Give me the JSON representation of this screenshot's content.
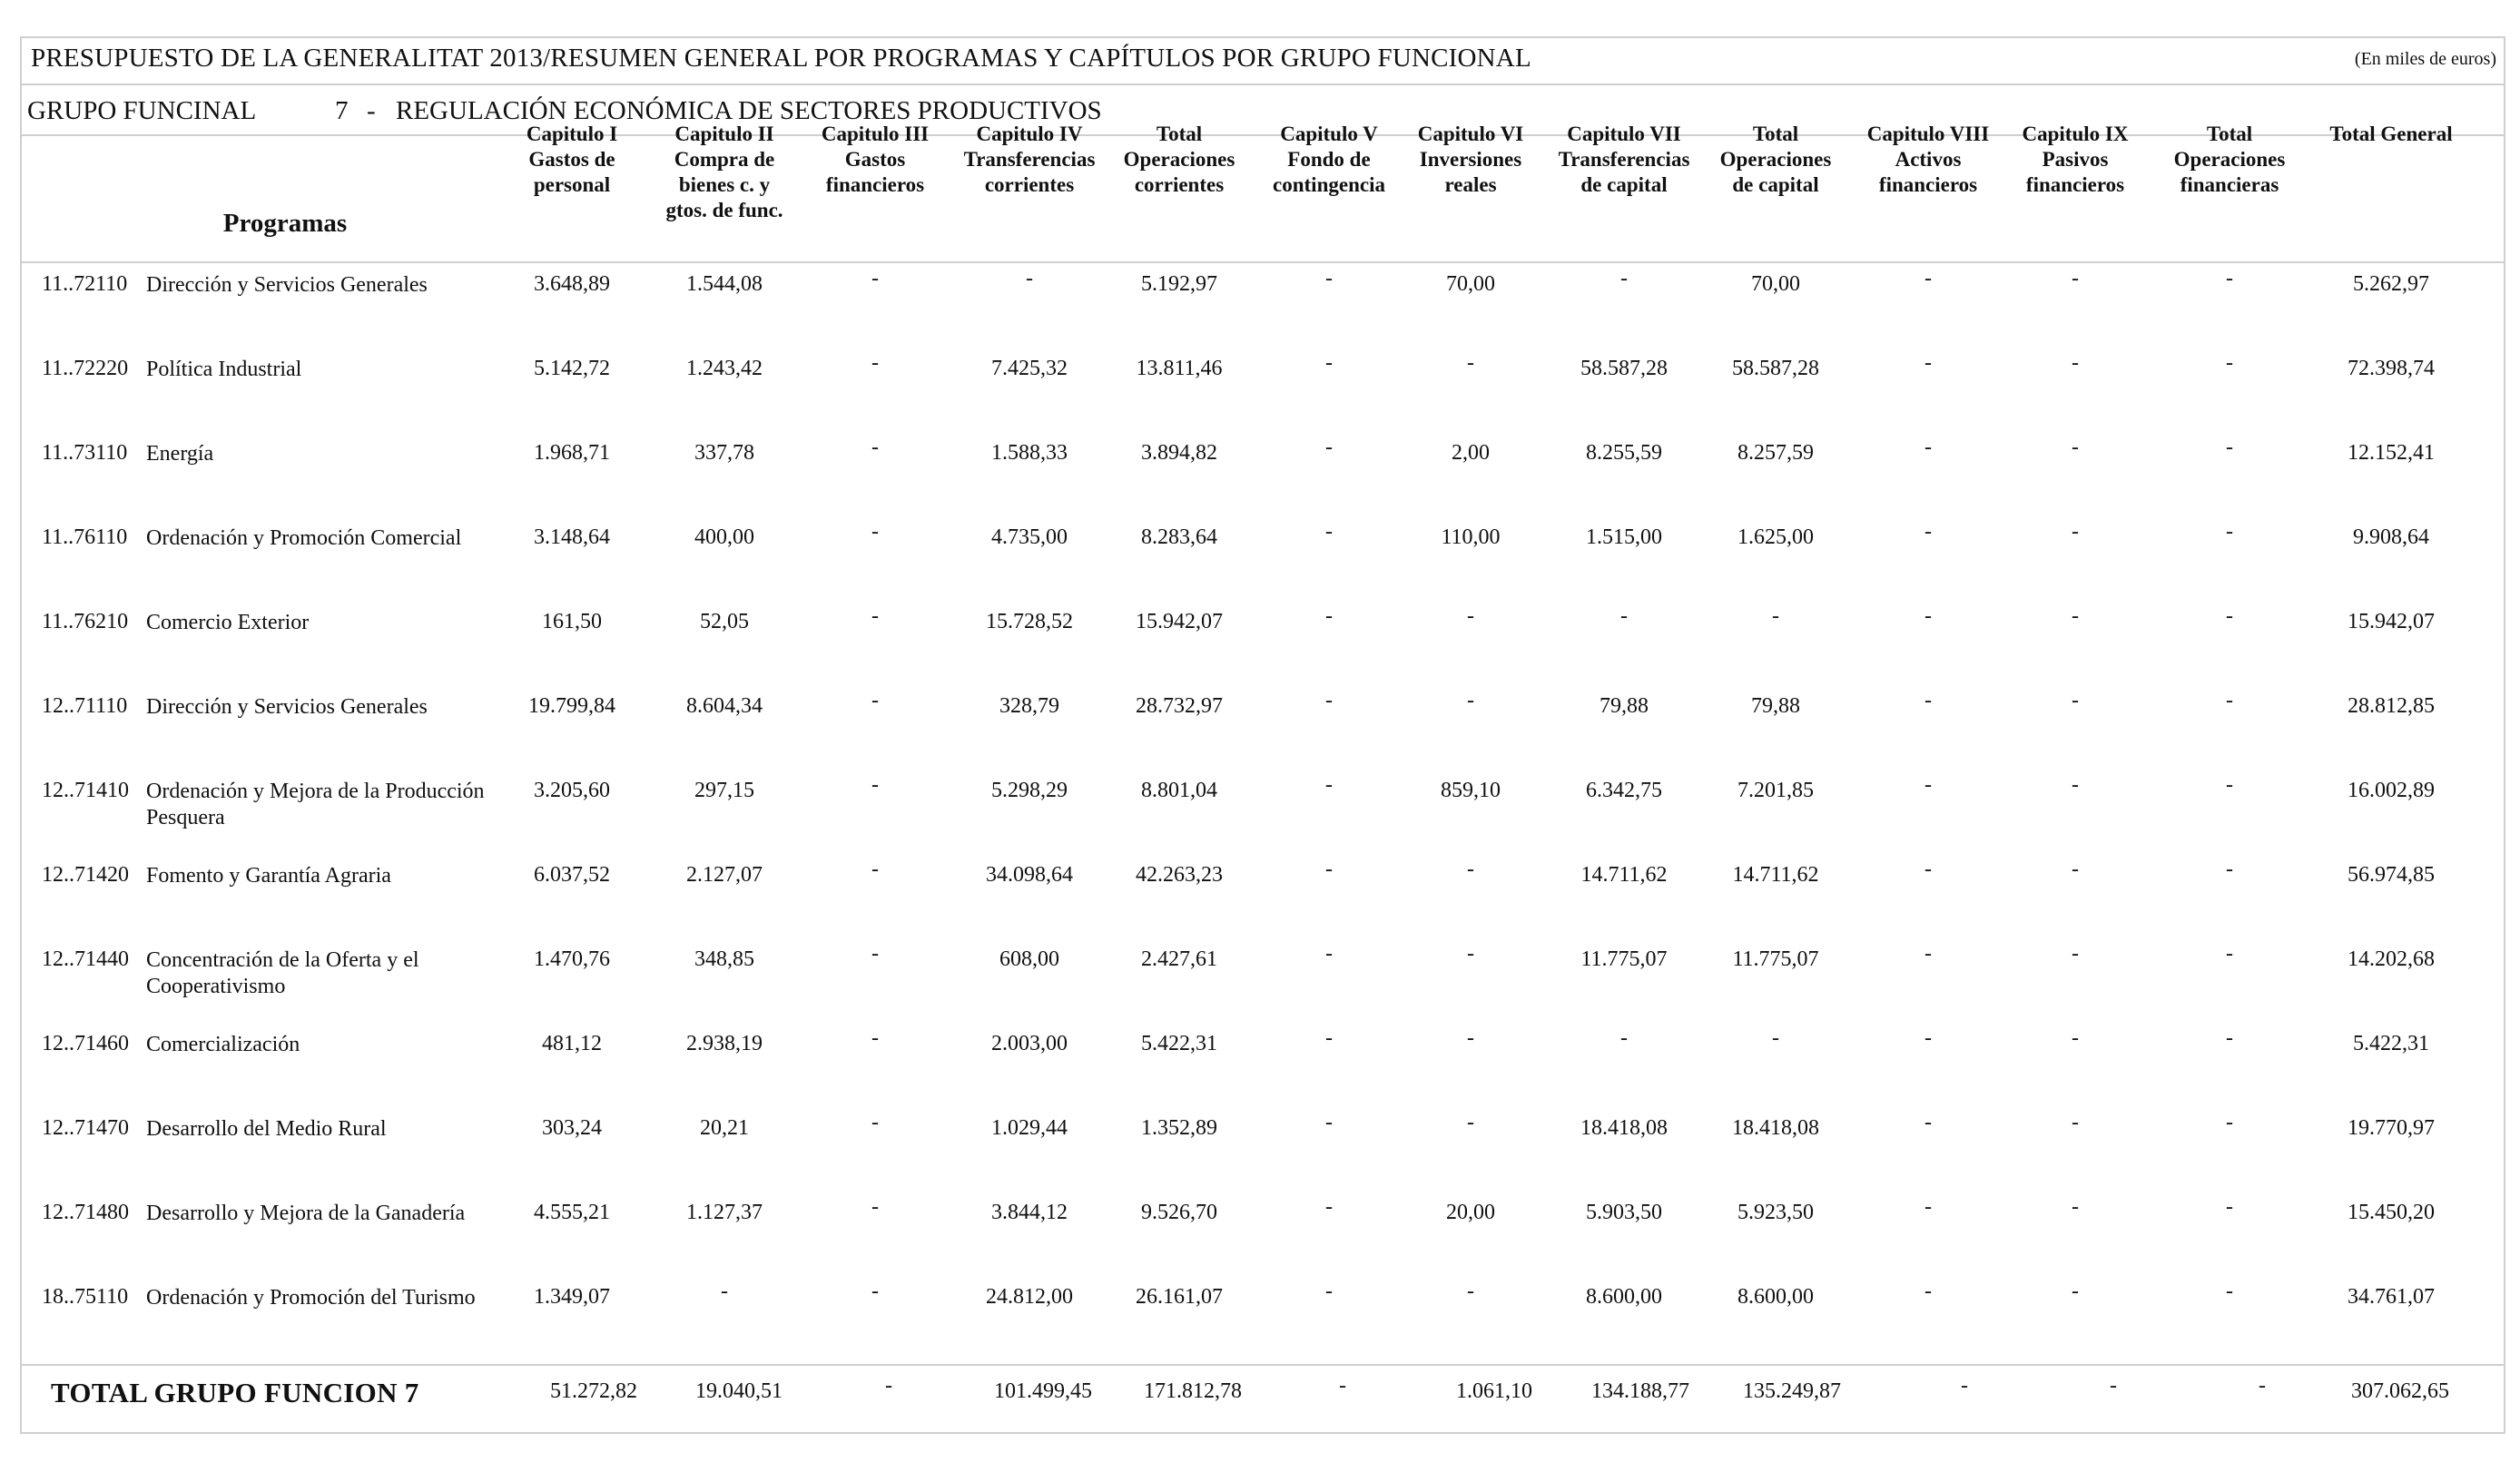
{
  "document": {
    "title": "PRESUPUESTO DE LA GENERALITAT 2013/RESUMEN GENERAL POR PROGRAMAS Y CAPÍTULOS POR GRUPO FUNCIONAL",
    "units": "(En miles de euros)",
    "group_label": "GRUPO FUNCINAL",
    "group_number": "7",
    "group_dash": "-",
    "group_name": "REGULACIÓN ECONÓMICA DE SECTORES PRODUCTIVOS"
  },
  "table": {
    "program_header": "Programas",
    "columns": [
      "Capitulo I\nGastos de\npersonal",
      "Capitulo II\nCompra de\nbienes c. y\ngtos. de func.",
      "Capitulo III\nGastos\nfinancieros",
      "Capitulo IV\nTransferencias\ncorrientes",
      "Total\nOperaciones\ncorrientes",
      "Capitulo V\nFondo de\ncontingencia",
      "Capitulo VI\nInversiones\nreales",
      "Capitulo VII\nTransferencias\nde capital",
      "Total\nOperaciones\nde capital",
      "Capitulo VIII\nActivos\nfinancieros",
      "Capitulo IX\nPasivos\nfinancieros",
      "Total\nOperaciones\nfinancieras",
      "Total General"
    ],
    "rows": [
      {
        "code": "11..72110",
        "name": "Dirección y Servicios Generales",
        "values": [
          "3.648,89",
          "1.544,08",
          "-",
          "-",
          "5.192,97",
          "-",
          "70,00",
          "-",
          "70,00",
          "-",
          "-",
          "-",
          "5.262,97"
        ]
      },
      {
        "code": "11..72220",
        "name": "Política Industrial",
        "values": [
          "5.142,72",
          "1.243,42",
          "-",
          "7.425,32",
          "13.811,46",
          "-",
          "-",
          "58.587,28",
          "58.587,28",
          "-",
          "-",
          "-",
          "72.398,74"
        ]
      },
      {
        "code": "11..73110",
        "name": "Energía",
        "values": [
          "1.968,71",
          "337,78",
          "-",
          "1.588,33",
          "3.894,82",
          "-",
          "2,00",
          "8.255,59",
          "8.257,59",
          "-",
          "-",
          "-",
          "12.152,41"
        ]
      },
      {
        "code": "11..76110",
        "name": "Ordenación y Promoción Comercial",
        "values": [
          "3.148,64",
          "400,00",
          "-",
          "4.735,00",
          "8.283,64",
          "-",
          "110,00",
          "1.515,00",
          "1.625,00",
          "-",
          "-",
          "-",
          "9.908,64"
        ]
      },
      {
        "code": "11..76210",
        "name": "Comercio Exterior",
        "values": [
          "161,50",
          "52,05",
          "-",
          "15.728,52",
          "15.942,07",
          "-",
          "-",
          "-",
          "-",
          "-",
          "-",
          "-",
          "15.942,07"
        ]
      },
      {
        "code": "12..71110",
        "name": "Dirección y Servicios Generales",
        "values": [
          "19.799,84",
          "8.604,34",
          "-",
          "328,79",
          "28.732,97",
          "-",
          "-",
          "79,88",
          "79,88",
          "-",
          "-",
          "-",
          "28.812,85"
        ]
      },
      {
        "code": "12..71410",
        "name": "Ordenación y Mejora de la Producción Pesquera",
        "values": [
          "3.205,60",
          "297,15",
          "-",
          "5.298,29",
          "8.801,04",
          "-",
          "859,10",
          "6.342,75",
          "7.201,85",
          "-",
          "-",
          "-",
          "16.002,89"
        ]
      },
      {
        "code": "12..71420",
        "name": "Fomento y Garantía Agraria",
        "values": [
          "6.037,52",
          "2.127,07",
          "-",
          "34.098,64",
          "42.263,23",
          "-",
          "-",
          "14.711,62",
          "14.711,62",
          "-",
          "-",
          "-",
          "56.974,85"
        ]
      },
      {
        "code": "12..71440",
        "name": "Concentración de la Oferta y el Cooperativismo",
        "values": [
          "1.470,76",
          "348,85",
          "-",
          "608,00",
          "2.427,61",
          "-",
          "-",
          "11.775,07",
          "11.775,07",
          "-",
          "-",
          "-",
          "14.202,68"
        ]
      },
      {
        "code": "12..71460",
        "name": "Comercialización",
        "values": [
          "481,12",
          "2.938,19",
          "-",
          "2.003,00",
          "5.422,31",
          "-",
          "-",
          "-",
          "-",
          "-",
          "-",
          "-",
          "5.422,31"
        ]
      },
      {
        "code": "12..71470",
        "name": "Desarrollo del Medio Rural",
        "values": [
          "303,24",
          "20,21",
          "-",
          "1.029,44",
          "1.352,89",
          "-",
          "-",
          "18.418,08",
          "18.418,08",
          "-",
          "-",
          "-",
          "19.770,97"
        ]
      },
      {
        "code": "12..71480",
        "name": "Desarrollo y Mejora de la Ganadería",
        "values": [
          "4.555,21",
          "1.127,37",
          "-",
          "3.844,12",
          "9.526,70",
          "-",
          "20,00",
          "5.903,50",
          "5.923,50",
          "-",
          "-",
          "-",
          "15.450,20"
        ]
      },
      {
        "code": "18..75110",
        "name": "Ordenación y Promoción del Turismo",
        "values": [
          "1.349,07",
          "-",
          "-",
          "24.812,00",
          "26.161,07",
          "-",
          "-",
          "8.600,00",
          "8.600,00",
          "-",
          "-",
          "-",
          "34.761,07"
        ]
      }
    ],
    "total": {
      "label": "TOTAL GRUPO FUNCION  7",
      "values": [
        "51.272,82",
        "19.040,51",
        "-",
        "101.499,45",
        "171.812,78",
        "-",
        "1.061,10",
        "134.188,77",
        "135.249,87",
        "-",
        "-",
        "-",
        "307.062,65"
      ]
    }
  }
}
